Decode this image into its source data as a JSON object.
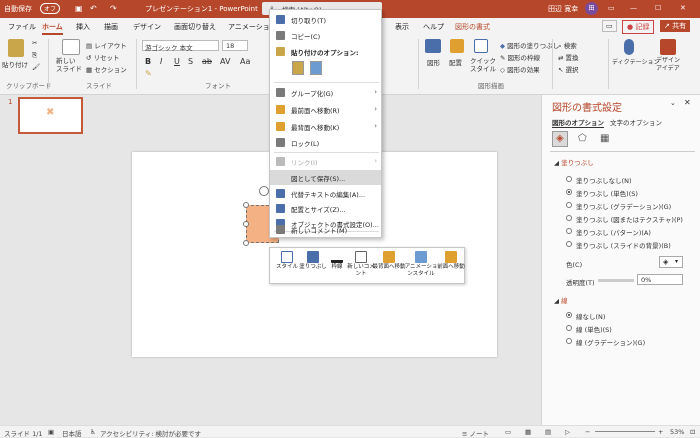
{
  "titlebar": {
    "autosave": "自動保存",
    "autosave_state": "オフ",
    "doc_title": "プレゼンテーション1 - PowerPoint",
    "search_label": "検索 (Alt+Q)",
    "user": "田辺 寛幸",
    "user_initial": "田"
  },
  "tabs": [
    "ファイル",
    "ホーム",
    "挿入",
    "描画",
    "デザイン",
    "画面切り替え",
    "アニメーション",
    "表示",
    "ヘルプ",
    "図形の書式"
  ],
  "ribbon": {
    "paste": "貼り付け",
    "clipboard": "クリップボード",
    "new_slide": "新しい\nスライド",
    "layout": "レイアウト",
    "reset": "リセット",
    "section": "セクション",
    "slides_group": "スライド",
    "font_name": "游ゴシック 本文",
    "font_size": "18",
    "font_group": "フォント",
    "shapes": "図形",
    "arrange": "配置",
    "quick_style": "クイック\nスタイル",
    "fill": "図形の塗りつぶし",
    "outline": "図形の枠線",
    "effects": "図形の効果",
    "drawing_group": "図形描画",
    "find": "検索",
    "replace": "置換",
    "select": "選択",
    "dictate": "ディクテーション",
    "designer": "デザイン\nアイデア",
    "record": "記録",
    "share": "共有"
  },
  "thumbnail": {
    "number": "1"
  },
  "context_menu": {
    "items": [
      {
        "label": "切り取り(T)",
        "arrow": "",
        "icon": "scissors-icon",
        "color": "#4a6ea9"
      },
      {
        "label": "コピー(C)",
        "arrow": "",
        "icon": "copy-icon",
        "color": "#7a7a7a"
      },
      {
        "label": "貼り付けのオプション:",
        "arrow": "",
        "icon": "paste-icon",
        "color": "#c9a64a",
        "bold": true
      },
      {
        "label": "グループ化(G)",
        "arrow": "›",
        "icon": "group-icon",
        "color": "#7a7a7a"
      },
      {
        "label": "最前面へ移動(R)",
        "arrow": "›",
        "icon": "bring-front-icon",
        "color": "#e0a030"
      },
      {
        "label": "最背面へ移動(K)",
        "arrow": "›",
        "icon": "send-back-icon",
        "color": "#e0a030"
      },
      {
        "label": "ロック(L)",
        "arrow": "",
        "icon": "lock-icon",
        "color": "#7a7a7a"
      },
      {
        "label": "リンク(I)",
        "arrow": "›",
        "icon": "link-icon",
        "color": "#bbbbbb",
        "disabled": true
      },
      {
        "label": "図として保存(S)...",
        "arrow": "",
        "icon": "",
        "color": ""
      },
      {
        "label": "代替テキストの編集(A)...",
        "arrow": "",
        "icon": "alt-text-icon",
        "color": "#4a6ea9"
      },
      {
        "label": "配置とサイズ(Z)...",
        "arrow": "",
        "icon": "size-icon",
        "color": "#4a6ea9"
      },
      {
        "label": "オブジェクトの書式設定(O)...",
        "arrow": "",
        "icon": "format-icon",
        "color": "#4a6ea9"
      },
      {
        "label": "新しいコメント(M)",
        "arrow": "",
        "icon": "comment-icon",
        "color": "#7a7a7a"
      }
    ]
  },
  "minibar": {
    "items": [
      {
        "label": "スタイル",
        "icon": "style-icon"
      },
      {
        "label": "塗りつぶし",
        "icon": "fill-icon"
      },
      {
        "label": "枠線",
        "icon": "outline-icon"
      },
      {
        "label": "新しいコメント",
        "icon": "comment-icon"
      },
      {
        "label": "最背面へ移動",
        "icon": "send-back-icon"
      },
      {
        "label": "アニメーションスタイル",
        "icon": "animation-icon"
      },
      {
        "label": "前面へ移動",
        "icon": "bring-forward-icon"
      }
    ]
  },
  "format_pane": {
    "title": "図形の書式設定",
    "tab_shape": "図形のオプション",
    "tab_text": "文字のオプション",
    "fill_section": "塗りつぶし",
    "fill_options": [
      "塗りつぶしなし(N)",
      "塗りつぶし (単色)(S)",
      "塗りつぶし (グラデーション)(G)",
      "塗りつぶし (図またはテクスチャ)(P)",
      "塗りつぶし (パターン)(A)",
      "塗りつぶし (スライドの背景)(B)"
    ],
    "fill_selected": 1,
    "color_label": "色(C)",
    "transparency_label": "透明度(T)",
    "transparency_value": "0%",
    "line_section": "線",
    "line_options": [
      "線なし(N)",
      "線 (単色)(S)",
      "線 (グラデーション)(G)"
    ],
    "line_selected": 0,
    "fill_color": "#f4b183"
  },
  "status": {
    "slide": "スライド 1/1",
    "lang": "日本語",
    "accessibility": "アクセシビリティ: 検討が必要です",
    "notes": "ノート",
    "zoom": "53%"
  }
}
